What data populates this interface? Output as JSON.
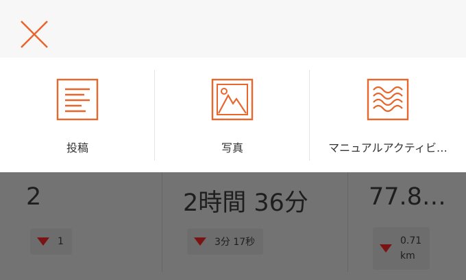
{
  "menu": {
    "items": [
      {
        "label": "投稿",
        "icon": "post-icon"
      },
      {
        "label": "写真",
        "icon": "photo-icon"
      },
      {
        "label": "マニュアルアクティビ…",
        "icon": "manual-activity-icon"
      }
    ]
  },
  "stats": [
    {
      "value": "2",
      "delta": "1"
    },
    {
      "value": "2時間 36分",
      "delta": "3分 17秒"
    },
    {
      "value": "77.8…",
      "delta_number": "0.71",
      "delta_unit": "km"
    }
  ],
  "colors": {
    "accent": "#e8652b",
    "decrease": "#7a1414",
    "overlay": "#737373"
  }
}
